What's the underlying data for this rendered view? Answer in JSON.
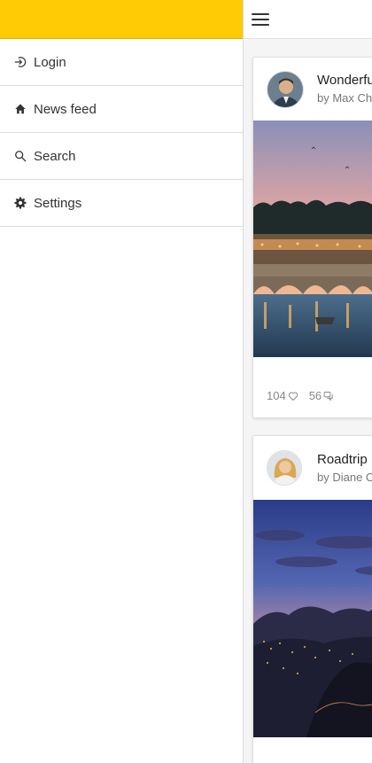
{
  "sidebar": {
    "items": [
      {
        "label": "Login",
        "icon": "login-icon"
      },
      {
        "label": "News feed",
        "icon": "home-icon"
      },
      {
        "label": "Search",
        "icon": "search-icon"
      },
      {
        "label": "Settings",
        "icon": "gear-icon"
      }
    ]
  },
  "feed": {
    "posts": [
      {
        "title": "Wonderful",
        "author": "by Max Ch",
        "likes": "104",
        "comments": "56"
      },
      {
        "title": "Roadtrip",
        "author": "by Diane C"
      }
    ]
  },
  "colors": {
    "accent": "#ffcb05",
    "border": "#dcdcdc",
    "text": "#333333"
  }
}
